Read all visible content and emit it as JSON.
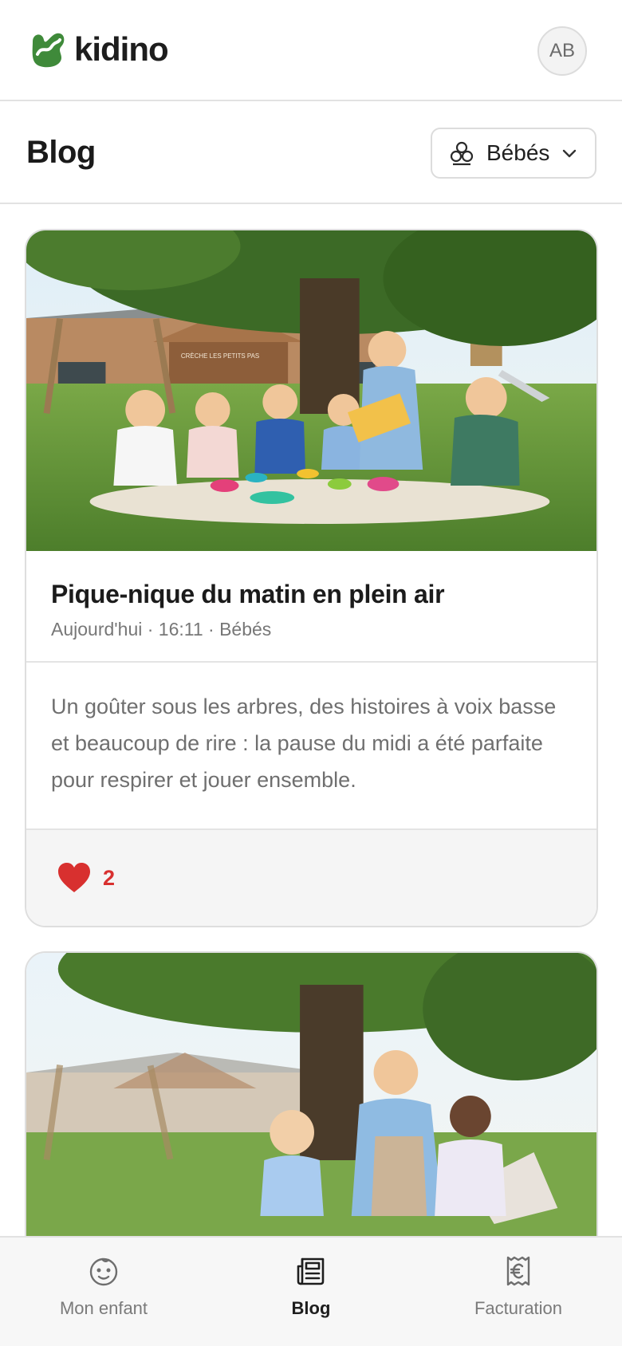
{
  "app": {
    "name": "kidino",
    "avatar_initials": "AB"
  },
  "header": {
    "page_title": "Blog",
    "filter": {
      "icon": "group-icon",
      "value": "Bébés"
    }
  },
  "posts": [
    {
      "title": "Pique-nique du matin en plein air",
      "meta": "Aujourd'hui · 16:11 · Bébés",
      "text": "Un goûter sous les arbres, des histoires à voix basse et beaucoup de rire : la pause du midi a été parfaite pour respirer et jouer ensemble.",
      "likes": "2",
      "image_sign": "CRÈCHE LES PETITS PAS"
    },
    {
      "title": "",
      "meta": "",
      "text": "",
      "likes": ""
    }
  ],
  "nav": {
    "items": [
      {
        "label": "Mon enfant",
        "icon": "baby-face-icon",
        "active": false
      },
      {
        "label": "Blog",
        "icon": "newspaper-icon",
        "active": true
      },
      {
        "label": "Facturation",
        "icon": "euro-receipt-icon",
        "active": false
      }
    ]
  },
  "colors": {
    "brand_green": "#3f8a3a",
    "like_red": "#d8302f",
    "border": "#dedede"
  }
}
